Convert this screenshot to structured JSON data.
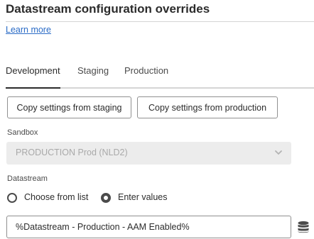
{
  "header": {
    "title": "Datastream configuration overrides",
    "learn_more": "Learn more"
  },
  "tabs": [
    {
      "label": "Development",
      "active": true
    },
    {
      "label": "Staging",
      "active": false
    },
    {
      "label": "Production",
      "active": false
    }
  ],
  "actions": {
    "copy_staging": "Copy settings from staging",
    "copy_production": "Copy settings from production"
  },
  "sandbox": {
    "label": "Sandbox",
    "value": "PRODUCTION Prod (NLD2)",
    "disabled": true
  },
  "datastream": {
    "label": "Datastream",
    "options": [
      {
        "label": "Choose from list",
        "selected": false
      },
      {
        "label": "Enter values",
        "selected": true
      }
    ],
    "value": "%Datastream - Production - AAM Enabled%",
    "data_element_icon": "database-icon"
  },
  "colors": {
    "link": "#2a6bc6",
    "text": "#2c2c2c",
    "disabled_bg": "#ececec",
    "disabled_text": "#a9a9a9"
  }
}
